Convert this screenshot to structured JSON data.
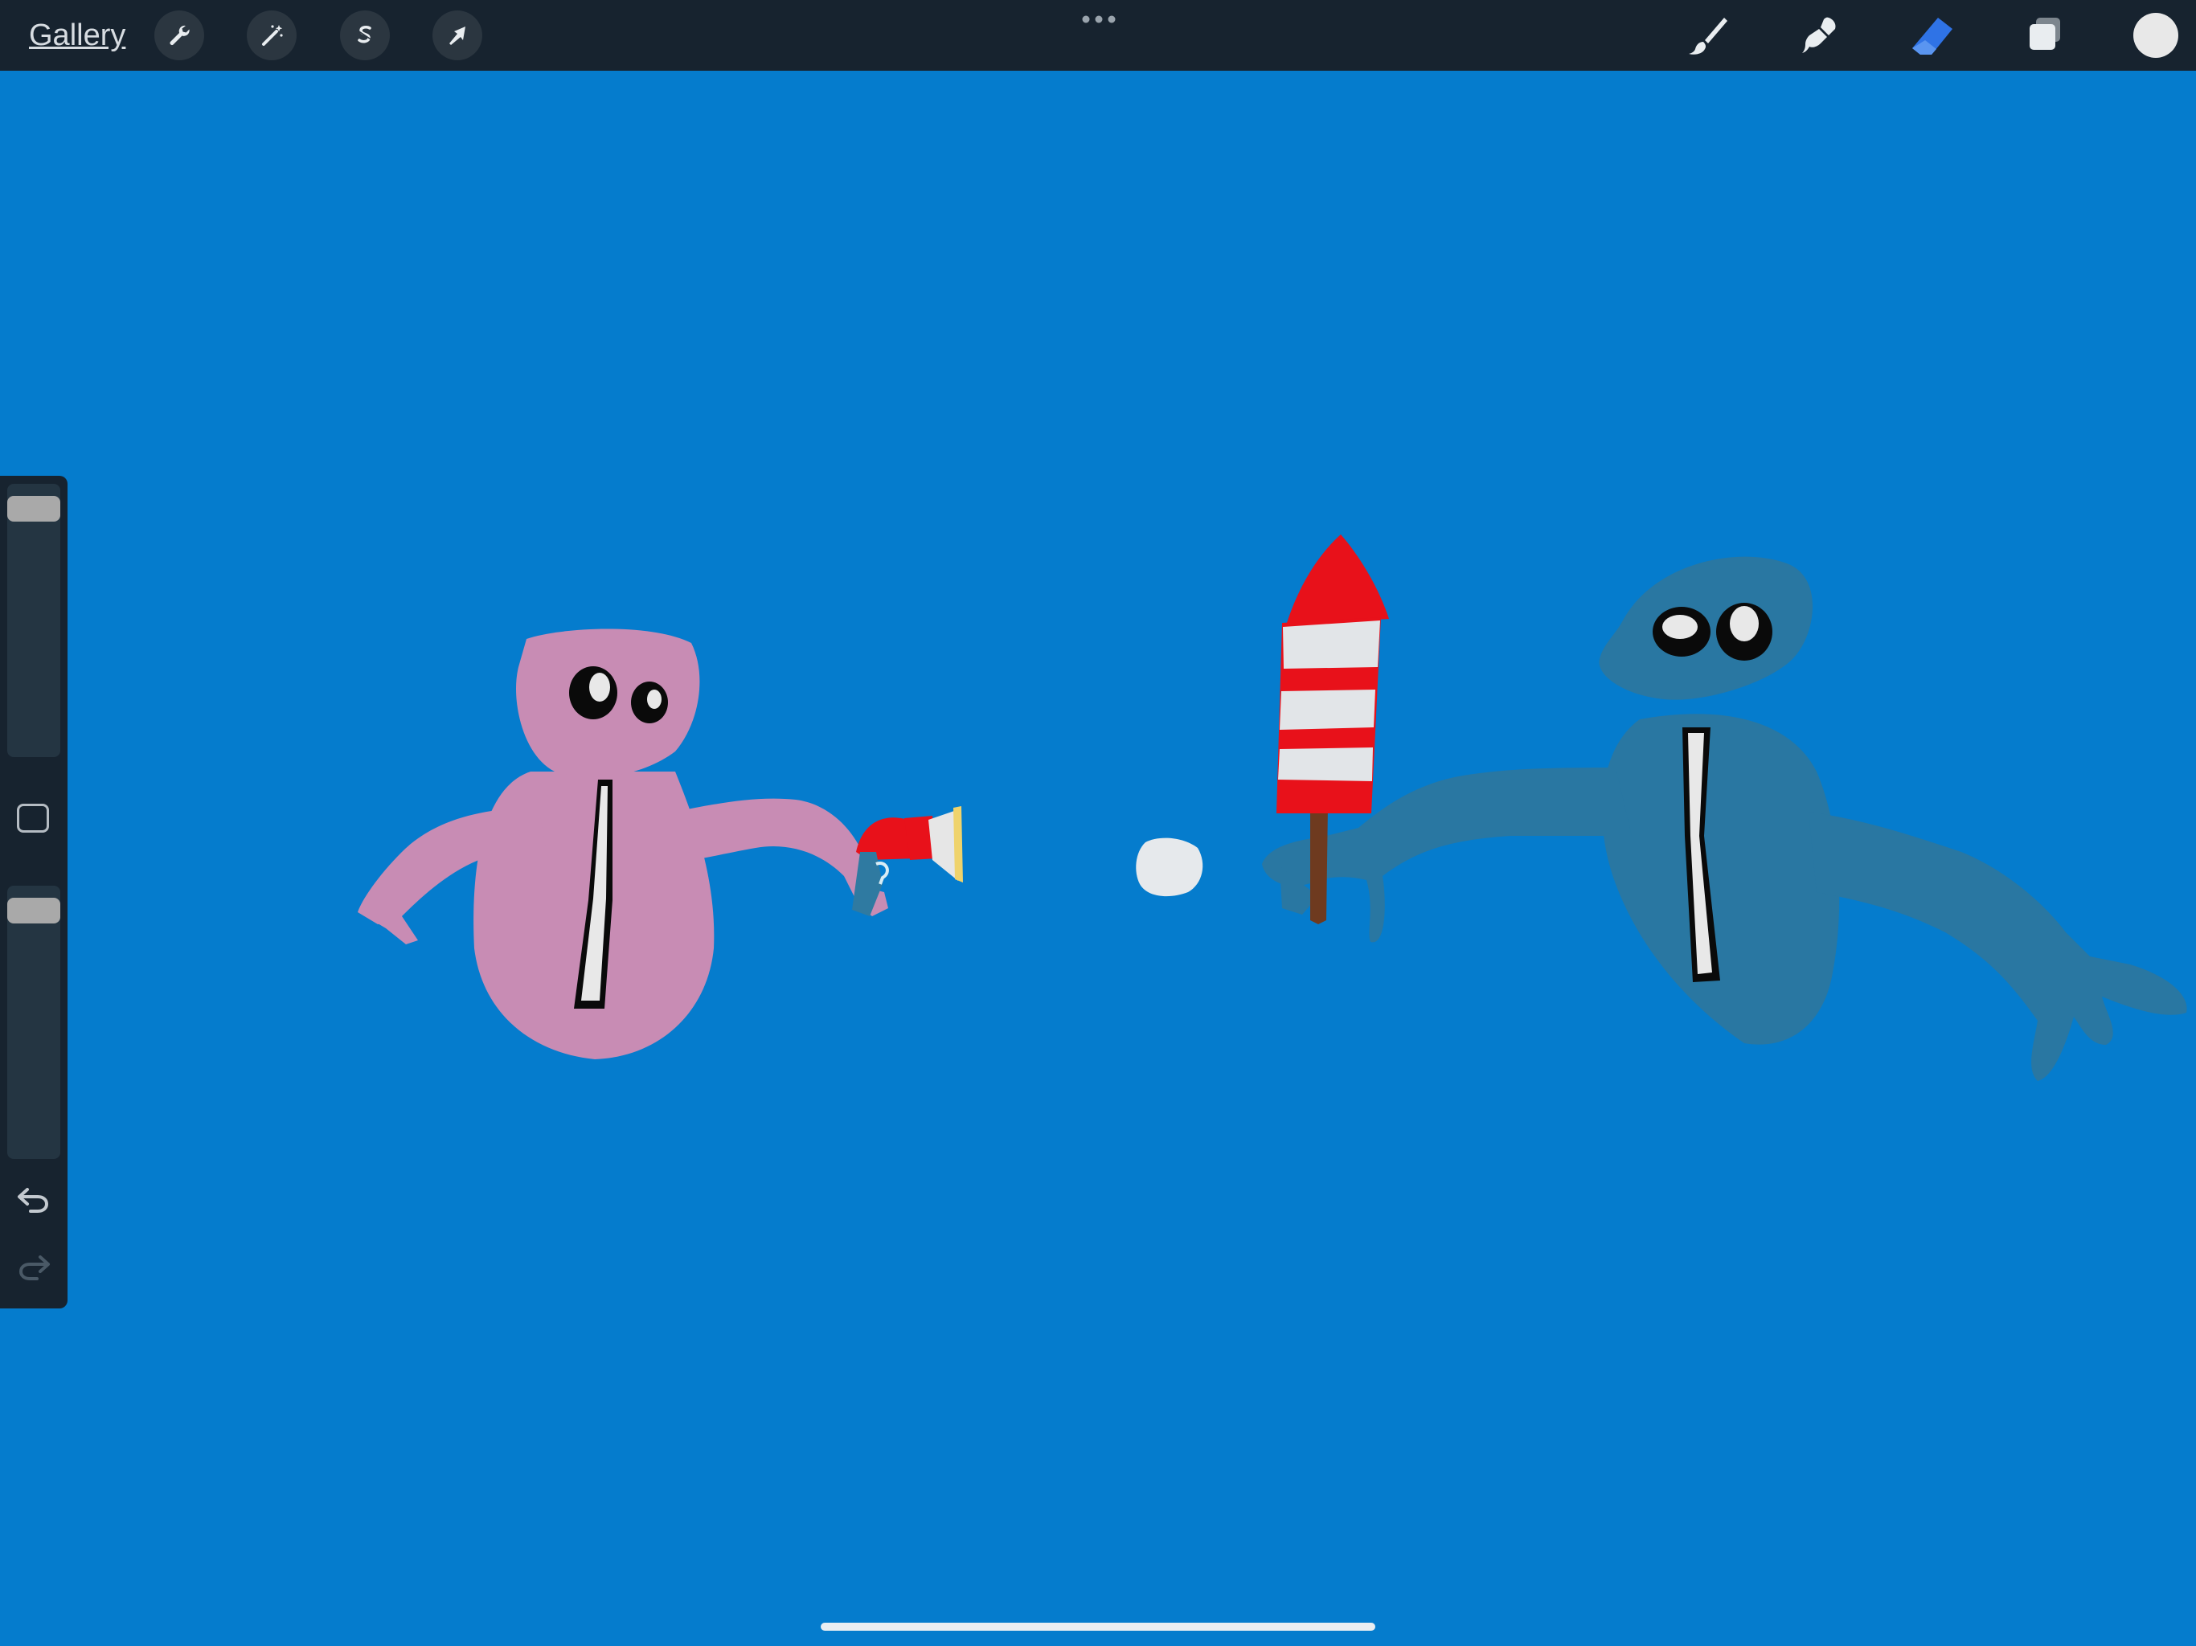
{
  "app": {
    "gallery_label": "Gallery"
  },
  "toolbar": {
    "left_tools": [
      "wrench-icon",
      "magic-wand-icon",
      "selection-s-icon",
      "transform-arrow-icon"
    ],
    "right_tools": [
      "brush-icon",
      "smudge-icon",
      "eraser-icon",
      "layers-icon"
    ],
    "active_tool": "eraser",
    "active_color": "#2f73e6",
    "current_color": "#e8e8e8"
  },
  "sidebar": {
    "brush_size_level": 0.96,
    "opacity_level": 0.96
  },
  "canvas": {
    "background": "#057ccd",
    "figures": [
      "pink-creature",
      "blue-creature",
      "firework-rocket",
      "party-popper",
      "smoke-puff"
    ]
  }
}
